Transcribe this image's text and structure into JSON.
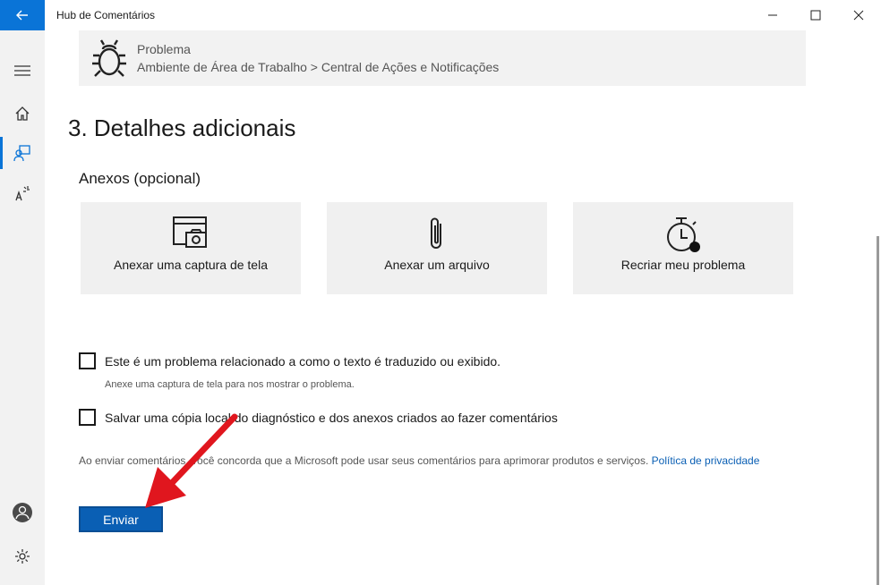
{
  "window": {
    "title": "Hub de Comentários"
  },
  "problem": {
    "label": "Problema",
    "path": "Ambiente de Área de Trabalho > Central de Ações e Notificações"
  },
  "section": {
    "title": "3. Detalhes adicionais",
    "attachments_label": "Anexos (opcional)"
  },
  "tiles": [
    {
      "label": "Anexar uma captura de tela",
      "icon": "screenshot-icon"
    },
    {
      "label": "Anexar um arquivo",
      "icon": "paperclip-icon"
    },
    {
      "label": "Recriar meu problema",
      "icon": "stopwatch-record-icon"
    }
  ],
  "checkboxes": [
    {
      "label": "Este é um problema relacionado a como o texto é traduzido ou exibido.",
      "checked": false,
      "hint": "Anexe uma captura de tela para nos mostrar o problema."
    },
    {
      "label": "Salvar uma cópia local do diagnóstico e dos anexos criados ao fazer comentários",
      "checked": false
    }
  ],
  "legal": {
    "text": "Ao enviar comentários, você concorda que a Microsoft pode usar seus comentários para aprimorar produtos e serviços. ",
    "link": "Política de privacidade"
  },
  "send_button": "Enviar",
  "colors": {
    "accent": "#0a74d7",
    "button": "#0a5fb4",
    "annotation_arrow": "#e0161e"
  }
}
